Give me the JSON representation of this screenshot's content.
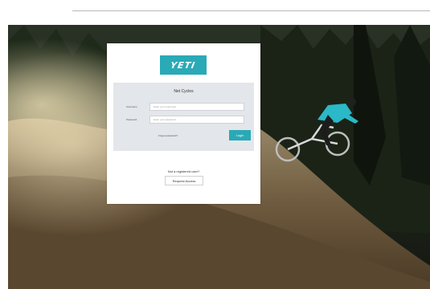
{
  "brand": {
    "logo_text": "YETI",
    "accent_color": "#2aa9b6"
  },
  "login": {
    "title": "Net Cycles",
    "username_label": "Username",
    "username_placeholder": "Enter your username",
    "password_label": "Password",
    "password_placeholder": "Enter your password",
    "forgot_label": "Forgot password?",
    "login_label": "Login"
  },
  "register": {
    "prompt": "Not a registered user?",
    "button_label": "Request Access"
  },
  "background": {
    "icon": "mountain-bike-photo-icon"
  }
}
